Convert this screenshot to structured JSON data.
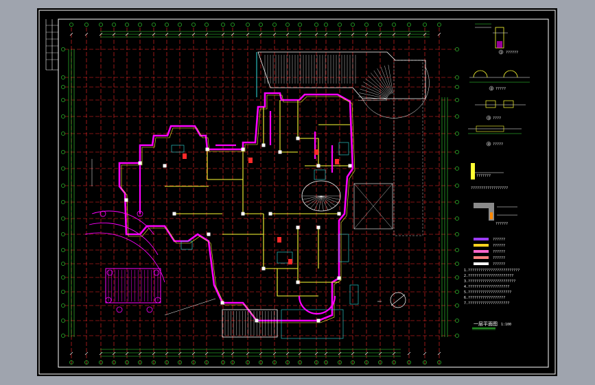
{
  "drawing": {
    "title_text": "一层平面图",
    "scale_text": "1:100",
    "notes_heading": "??????????????????",
    "title_block_cells": [
      "",
      "",
      "",
      "",
      "",
      "",
      "",
      ""
    ]
  },
  "legend": {
    "items": [
      {
        "label": "??????",
        "color": "#9b3cff"
      },
      {
        "label": "??????",
        "color": "#ffd21f"
      },
      {
        "label": "??????",
        "color": "#ff66cc"
      },
      {
        "label": "??????",
        "color": "#ff8080"
      },
      {
        "label": "??????",
        "color": "#ffffff"
      }
    ]
  },
  "notes": {
    "lines": [
      "1.?????????????????????????",
      "2.??????????????????????",
      "3.???????????????????????",
      "4.????????????????????",
      "5.?????????????????????",
      "6.??????????????????",
      "7.????????????????????"
    ]
  },
  "details": {
    "labels": [
      "①",
      "②",
      "③",
      "④",
      "⑤",
      "⑥"
    ],
    "captions": [
      "??????",
      "?????",
      "????",
      "?????",
      "???????",
      "??????"
    ]
  },
  "colors": {
    "background": "#000000",
    "frame": "#ffffff",
    "axis": "#ff2a2a",
    "grid_green": "#37e637",
    "wall_magenta": "#ff00ff",
    "wall_yellow": "#ffff33",
    "cyan": "#30e0e0",
    "white": "#ffffff"
  }
}
